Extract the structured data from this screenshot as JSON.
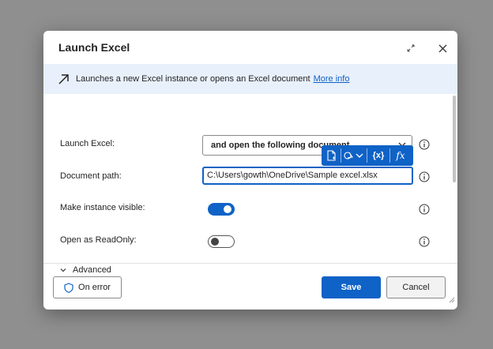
{
  "dialog": {
    "title": "Launch Excel",
    "banner": {
      "description": "Launches a new Excel instance or opens an Excel document",
      "link": "More info"
    }
  },
  "form": {
    "launch_excel": {
      "label": "Launch Excel:",
      "value": "and open the following document"
    },
    "document_path": {
      "label": "Document path:",
      "value": "C:\\Users\\gowth\\OneDrive\\Sample excel.xlsx"
    },
    "make_visible": {
      "label": "Make instance visible:",
      "checked": true
    },
    "read_only": {
      "label": "Open as ReadOnly:",
      "checked": false
    },
    "advanced": {
      "label": "Advanced"
    }
  },
  "toolbar": {
    "variables": "{x}",
    "expression": "fx"
  },
  "footer": {
    "on_error": "On error",
    "save": "Save",
    "cancel": "Cancel"
  },
  "colors": {
    "accent": "#0f62c6",
    "banner_bg": "#e8f0fb",
    "backdrop": "#8f8f8f"
  }
}
